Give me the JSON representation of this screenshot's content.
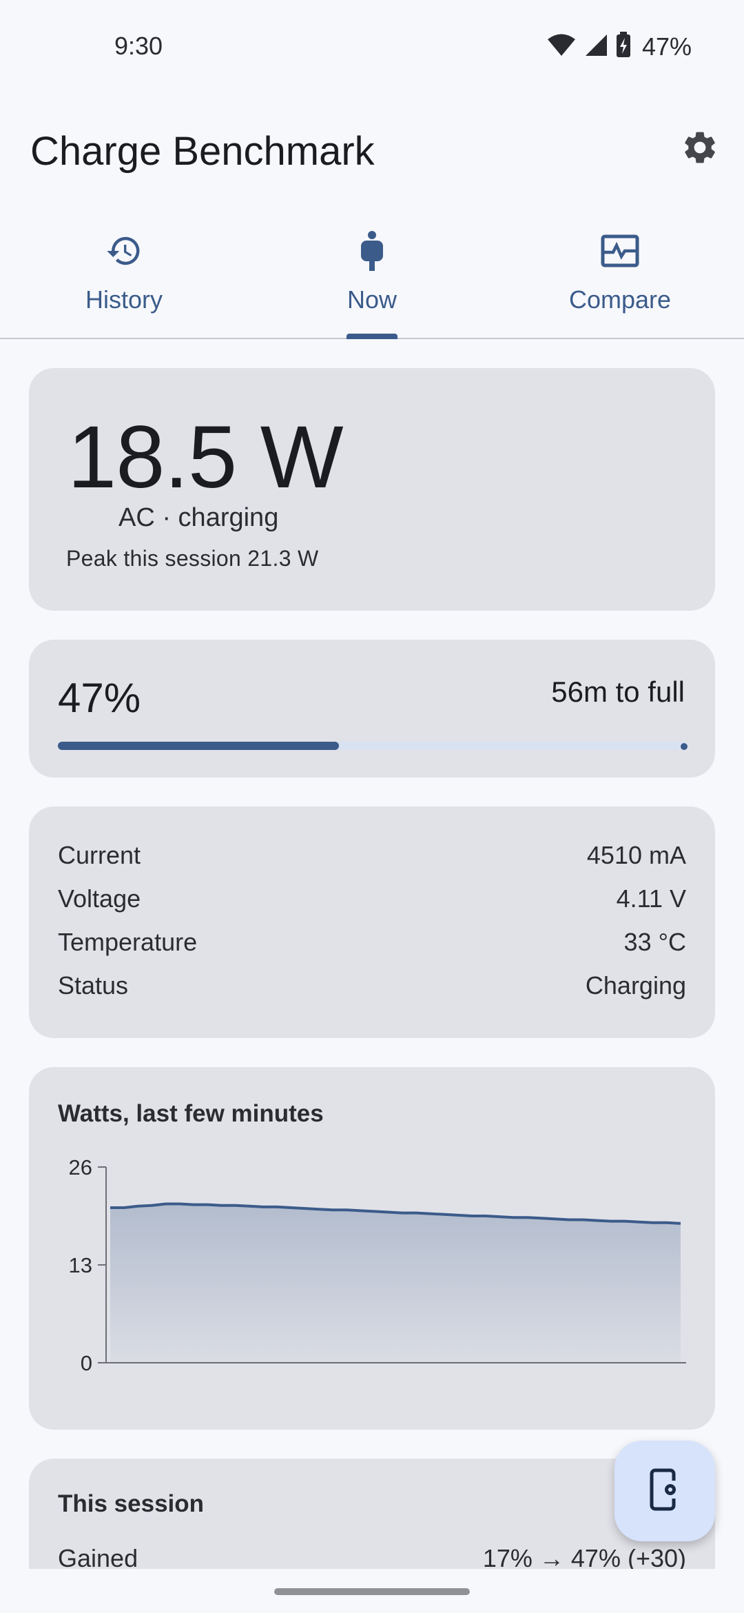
{
  "status_bar": {
    "time": "9:30",
    "battery_percent": "47%",
    "icons": [
      "wifi-icon",
      "cell-signal-icon",
      "battery-charging-icon"
    ]
  },
  "app_bar": {
    "title": "Charge Benchmark",
    "settings_icon": "gear-icon"
  },
  "tabs": [
    {
      "label": "History",
      "icon": "history-icon",
      "selected": false
    },
    {
      "label": "Now",
      "icon": "plug-icon",
      "selected": true
    },
    {
      "label": "Compare",
      "icon": "compare-chart-icon",
      "selected": false
    }
  ],
  "power": {
    "value": "18.5 W",
    "source_state": "AC · charging",
    "peak": "Peak this session 21.3 W"
  },
  "level": {
    "percent_text": "47%",
    "percent": 47,
    "eta": "56m to full"
  },
  "stats": [
    {
      "label": "Current",
      "value": "4510 mA"
    },
    {
      "label": "Voltage",
      "value": "4.11 V"
    },
    {
      "label": "Temperature",
      "value": "33 °C"
    },
    {
      "label": "Status",
      "value": "Charging"
    }
  ],
  "chart": {
    "title": "Watts, last few minutes"
  },
  "chart_data": {
    "type": "area",
    "title": "Watts, last few minutes",
    "xlabel": "",
    "ylabel": "",
    "ylim": [
      0,
      26
    ],
    "yticks": [
      0,
      13,
      26
    ],
    "y": [
      20.6,
      20.6,
      20.8,
      20.9,
      21.1,
      21.1,
      21.0,
      21.0,
      20.9,
      20.9,
      20.8,
      20.7,
      20.7,
      20.6,
      20.5,
      20.4,
      20.3,
      20.3,
      20.2,
      20.1,
      20.0,
      19.9,
      19.9,
      19.8,
      19.7,
      19.6,
      19.5,
      19.5,
      19.4,
      19.3,
      19.3,
      19.2,
      19.1,
      19.0,
      19.0,
      18.9,
      18.8,
      18.8,
      18.7,
      18.6,
      18.6,
      18.5
    ],
    "color": "#3b5b8a",
    "grid": false
  },
  "session": {
    "title": "This session",
    "rows": [
      {
        "label": "Gained",
        "value": "17% → 47% (+30)"
      }
    ]
  },
  "fab": {
    "icon": "phone-settings-icon"
  },
  "colors": {
    "accent": "#3b5b8a",
    "card": "#e1e2e8",
    "background": "#f7f8fc",
    "fab": "#d6e3fb"
  }
}
